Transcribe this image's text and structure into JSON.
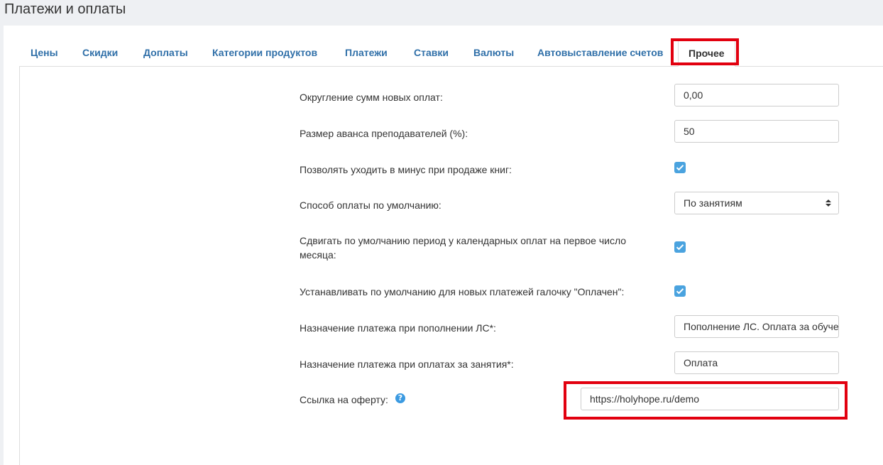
{
  "page": {
    "title": "Платежи и оплаты"
  },
  "tabs": [
    {
      "label": "Цены"
    },
    {
      "label": "Скидки"
    },
    {
      "label": "Доплаты"
    },
    {
      "label": "Категории продуктов"
    },
    {
      "label": "Платежи"
    },
    {
      "label": "Ставки"
    },
    {
      "label": "Валюты"
    },
    {
      "label": "Автовыставление счетов"
    },
    {
      "label": "Прочее",
      "active": true
    }
  ],
  "settings": {
    "rounding": {
      "label": "Округление сумм новых оплат:",
      "value": "0,00"
    },
    "advance": {
      "label": "Размер аванса преподавателей (%):",
      "value": "50"
    },
    "negative_books": {
      "label": "Позволять уходить в минус при продаже книг:",
      "checked": true
    },
    "payment_method": {
      "label": "Способ оплаты по умолчанию:",
      "value": "По занятиям"
    },
    "shift_period": {
      "label_line1": "Сдвигать по умолчанию период у календарных оплат на первое число",
      "label_line2": "месяца:",
      "checked": true
    },
    "paid_default": {
      "label": "Устанавливать по умолчанию для новых платежей галочку \"Оплачен\":",
      "checked": true
    },
    "purpose_topup": {
      "label": "Назначение платежа при пополнении ЛС*:",
      "value": "Пополнение ЛС. Оплата за обучение"
    },
    "purpose_lessons": {
      "label": "Назначение платежа при оплатах за занятия*:",
      "value": "Оплата"
    },
    "offer_link": {
      "label": "Ссылка на оферту:",
      "value": "https://holyhope.ru/demo",
      "help_icon": "?"
    }
  },
  "colors": {
    "highlight": "#e2000f",
    "tab_link": "#2f6fa8",
    "checkbox": "#4aa3df",
    "help": "#3b9ae1"
  }
}
